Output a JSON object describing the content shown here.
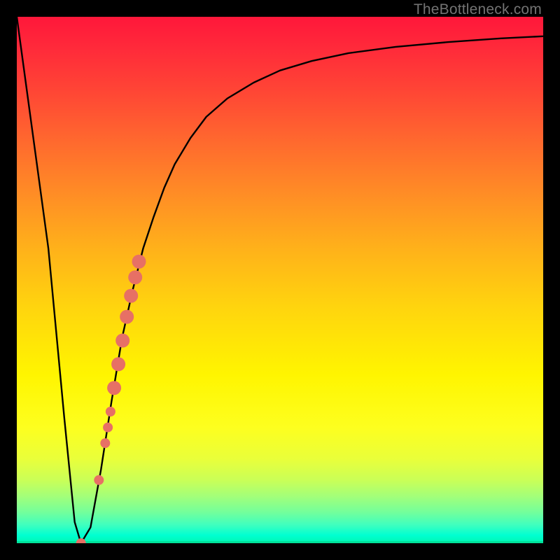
{
  "watermark": "TheBottleneck.com",
  "chart_data": {
    "type": "line",
    "title": "",
    "xlabel": "",
    "ylabel": "",
    "xlim": [
      0,
      100
    ],
    "ylim": [
      0,
      100
    ],
    "series": [
      {
        "name": "bottleneck-curve",
        "x": [
          0,
          6,
          9,
          11,
          12.2,
          14,
          16,
          18,
          20,
          22,
          24,
          26,
          28,
          30,
          33,
          36,
          40,
          45,
          50,
          56,
          63,
          72,
          82,
          92,
          100
        ],
        "values": [
          100,
          56,
          24,
          4,
          0,
          3,
          14,
          27,
          39,
          48,
          56,
          62,
          67.5,
          72,
          77,
          81,
          84.5,
          87.5,
          89.8,
          91.6,
          93.1,
          94.3,
          95.2,
          95.9,
          96.3
        ]
      }
    ],
    "markers": {
      "name": "highlighted-points",
      "color": "#e77065",
      "points": [
        {
          "x": 12.2,
          "y": 0,
          "r": 7
        },
        {
          "x": 15.6,
          "y": 12,
          "r": 7
        },
        {
          "x": 16.8,
          "y": 19,
          "r": 7
        },
        {
          "x": 17.3,
          "y": 22,
          "r": 7
        },
        {
          "x": 17.8,
          "y": 25,
          "r": 7
        },
        {
          "x": 18.5,
          "y": 29.5,
          "r": 10
        },
        {
          "x": 19.3,
          "y": 34,
          "r": 10
        },
        {
          "x": 20.1,
          "y": 38.5,
          "r": 10
        },
        {
          "x": 20.9,
          "y": 43,
          "r": 10
        },
        {
          "x": 21.7,
          "y": 47,
          "r": 10
        },
        {
          "x": 22.5,
          "y": 50.5,
          "r": 10
        },
        {
          "x": 23.2,
          "y": 53.5,
          "r": 10
        }
      ]
    },
    "gradient_stops": [
      {
        "pos": 0,
        "color": "#ff173a"
      },
      {
        "pos": 0.55,
        "color": "#ffd40e"
      },
      {
        "pos": 0.78,
        "color": "#fdff1f"
      },
      {
        "pos": 1.0,
        "color": "#00f7b1"
      }
    ]
  }
}
